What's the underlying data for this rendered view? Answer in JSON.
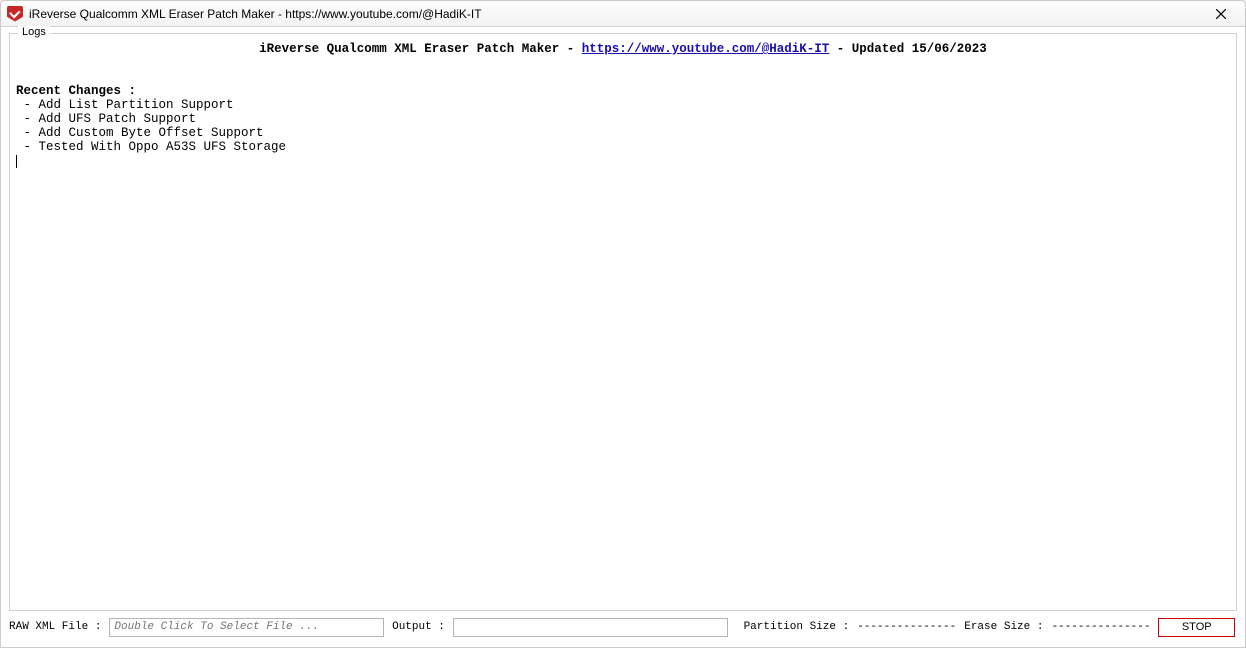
{
  "titlebar": {
    "title": "iReverse Qualcomm XML Eraser Patch Maker - https://www.youtube.com/@HadiK-IT"
  },
  "logs": {
    "label": "Logs",
    "banner_prefix": "iReverse Qualcomm XML Eraser Patch Maker - ",
    "banner_link_text": "https://www.youtube.com/@HadiK-IT",
    "banner_suffix": " - Updated 15/06/2023",
    "blank": "",
    "recent_header": "Recent Changes :",
    "change_1": " - Add List Partition Support",
    "change_2": " - Add UFS Patch Support",
    "change_3": " - Add Custom Byte Offset Support",
    "change_4": " - Tested With Oppo A53S UFS Storage"
  },
  "bottom": {
    "raw_xml_label": "RAW XML File :",
    "raw_xml_placeholder": "Double Click To Select File ...",
    "output_label": "Output :",
    "output_value": "",
    "partition_size_label": "Partition Size :",
    "partition_size_value": "---------------",
    "erase_size_label": "Erase Size :",
    "erase_size_value": "---------------",
    "stop_label": "STOP"
  }
}
